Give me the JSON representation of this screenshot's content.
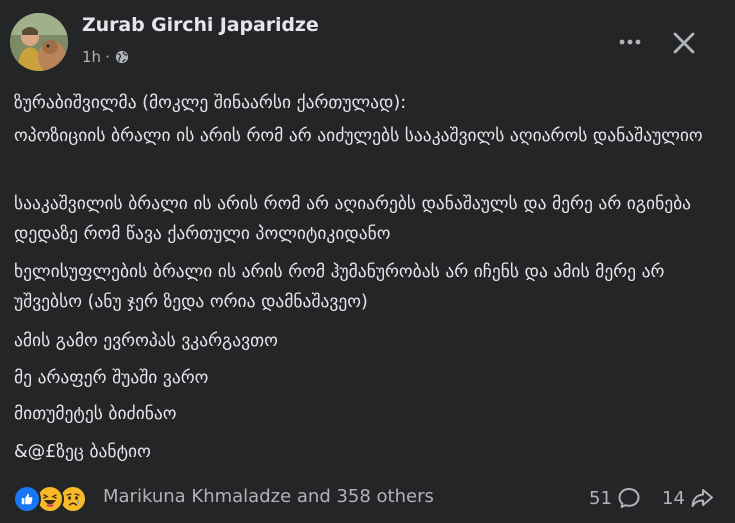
{
  "post": {
    "author": "Zurab Girchi Japaridze",
    "time": "1h",
    "separator": "·",
    "privacy_icon": "globe-icon",
    "more_icon": "more-options-icon",
    "close_icon": "close-icon",
    "paragraphs": [
      "ზურაბიშვილმა (მოკლე შინაარსი ქართულად):",
      "ოპოზიციის ბრალი ის არის რომ არ აიძულებს სააკაშვილს აღიაროს დანაშაულიო",
      "სააკაშვილის ბრალი ის არის რომ არ აღიარებს დანაშაულს და მერე არ იგინება დედაზე რომ წავა ქართული პოლიტიკიდანო",
      "ხელისუფლების ბრალი ის არის რომ ჰუმანურობას არ იჩენს და ამის მერე არ უშვებსო (ანუ ჯერ ზედა ორია დამნაშავეო)",
      "ამის გამო ევროპას ვკარგავთო",
      "მე არაფერ შუაში ვარო",
      "მითუმეტეს ბიძინაო",
      "&@£ზეც ბანტიო"
    ]
  },
  "footer": {
    "reactions": [
      "like-icon",
      "haha-icon",
      "sad-icon"
    ],
    "reactors_text": "Marikuna Khmaladze and 358 others",
    "comments_count": "51",
    "shares_count": "14",
    "comment_icon": "comment-icon",
    "share_icon": "share-icon"
  },
  "colors": {
    "background": "#242526",
    "text_primary": "#e4e6eb",
    "text_secondary": "#b0b3b8",
    "like_blue": "#1877f2",
    "emoji_yellow": "#f7b928"
  }
}
